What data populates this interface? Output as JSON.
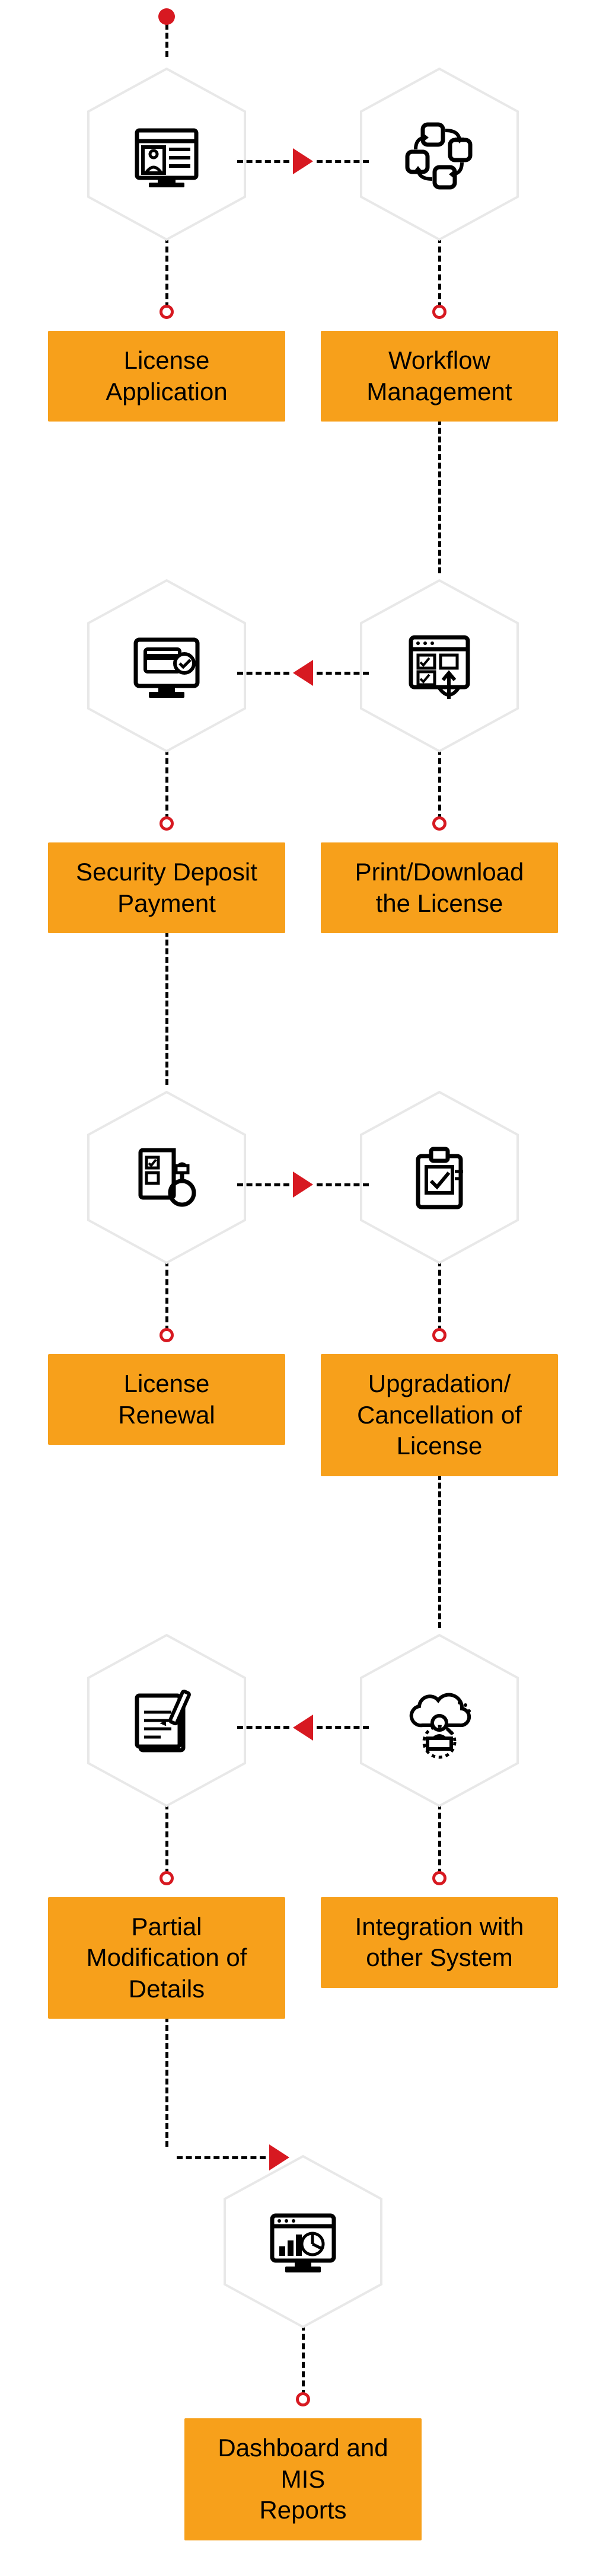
{
  "nodes": {
    "n1": {
      "label": "License\nApplication",
      "icon": "license-application-icon"
    },
    "n2": {
      "label": "Workflow\nManagement",
      "icon": "workflow-management-icon"
    },
    "n3": {
      "label": "Security Deposit\nPayment",
      "icon": "security-deposit-payment-icon"
    },
    "n4": {
      "label": "Print/Download\nthe License",
      "icon": "print-download-license-icon"
    },
    "n5": {
      "label": "License\nRenewal",
      "icon": "license-renewal-icon"
    },
    "n6": {
      "label": "Upgradation/\nCancellation of\nLicense",
      "icon": "upgradation-cancellation-icon"
    },
    "n7": {
      "label": "Partial\nModification of\nDetails",
      "icon": "partial-modification-icon"
    },
    "n8": {
      "label": "Integration with\nother System",
      "icon": "integration-other-system-icon"
    },
    "n9": {
      "label": "Dashboard and MIS\nReports",
      "icon": "dashboard-mis-reports-icon"
    }
  },
  "flow": [
    [
      "n1",
      "n2"
    ],
    [
      "n3",
      "n4"
    ],
    [
      "n5",
      "n6"
    ],
    [
      "n7",
      "n8"
    ],
    [
      "n9"
    ]
  ],
  "horizontal_arrows": [
    {
      "between_row": 0,
      "direction": "right"
    },
    {
      "between_row": 1,
      "direction": "left"
    },
    {
      "between_row": 2,
      "direction": "right"
    },
    {
      "between_row": 3,
      "direction": "left"
    }
  ],
  "vertical_links": [
    {
      "from_row": 0,
      "column": "right"
    },
    {
      "from_row": 1,
      "column": "left"
    },
    {
      "from_row": 2,
      "column": "right"
    },
    {
      "from_row": 3,
      "column": "left_then_right_to_center"
    }
  ],
  "colors": {
    "accent_orange": "#f7a01b",
    "accent_red": "#d71921",
    "stroke": "#000000",
    "hex_border": "#e8e8e8"
  }
}
